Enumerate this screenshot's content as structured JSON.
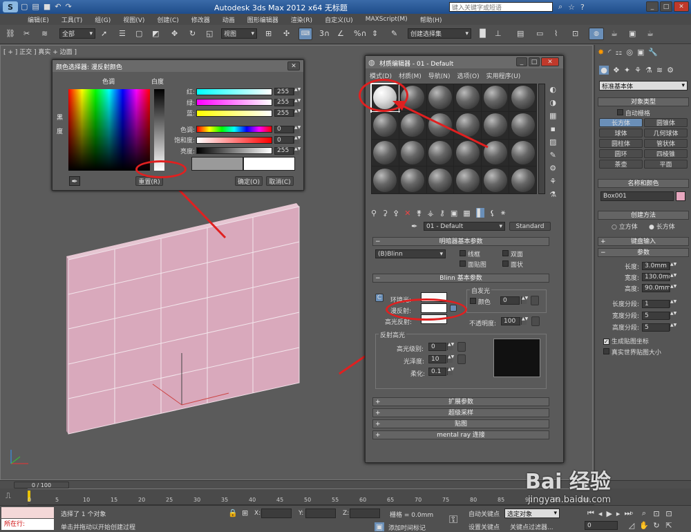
{
  "titlebar": {
    "title": "Autodesk 3ds Max  2012 x64      无标题",
    "search_placeholder": "键入关键字或短语"
  },
  "menu": [
    "编辑(E)",
    "工具(T)",
    "组(G)",
    "视图(V)",
    "创建(C)",
    "修改器",
    "动画",
    "图形编辑器",
    "渲染(R)",
    "自定义(U)",
    "MAXScript(M)",
    "帮助(H)"
  ],
  "toolbar": {
    "filter": "全部",
    "view": "视图",
    "selset": "创建选择集",
    "spinner_label": "3"
  },
  "viewport_label": "[ + ] 正交 ] 真实 + 边面 ]",
  "color_picker": {
    "title": "颜色选择器: 漫反射颜色",
    "hue_label": "色调",
    "white_label": "白度",
    "black_label": "黑",
    "deg_label": "度",
    "rows": [
      {
        "label": "红:",
        "value": "255",
        "grad": "linear-gradient(90deg,#0ff,#fff)"
      },
      {
        "label": "绿:",
        "value": "255",
        "grad": "linear-gradient(90deg,#f0f,#fff)"
      },
      {
        "label": "蓝:",
        "value": "255",
        "grad": "linear-gradient(90deg,#ff0,#fff)"
      },
      {
        "label": "色调:",
        "value": "0",
        "grad": "linear-gradient(90deg,#f00,#ff0,#0f0,#0ff,#00f,#f0f,#f00)"
      },
      {
        "label": "饱和度:",
        "value": "0",
        "grad": "linear-gradient(90deg,#fff,#f00)"
      },
      {
        "label": "亮度:",
        "value": "255",
        "grad": "linear-gradient(90deg,#000,#fff)"
      }
    ],
    "reset": "重置(R)",
    "ok": "确定(O)",
    "cancel": "取消(C)"
  },
  "mat_editor": {
    "title": "材质编辑器 - 01 - Default",
    "menu": [
      "模式(D)",
      "材质(M)",
      "导航(N)",
      "选项(O)",
      "实用程序(U)"
    ],
    "material_name": "01 - Default",
    "material_type": "Standard",
    "shader_rollout": "明暗器基本参数",
    "shader": "(B)Blinn",
    "wire": "线框",
    "two_sided": "双面",
    "face_map": "面贴图",
    "faceted": "面状",
    "blinn_rollout": "Blinn 基本参数",
    "self_illum": "自发光",
    "color_label": "颜色",
    "self_val": "0",
    "ambient": "环境光:",
    "diffuse": "漫反射:",
    "specular": "高光反射:",
    "opacity_label": "不透明度:",
    "opacity": "100",
    "highlight_group": "反射高光",
    "spec_level_label": "高光级别:",
    "spec_level": "0",
    "gloss_label": "光泽度:",
    "gloss": "10",
    "soften_label": "柔化:",
    "soften": "0.1",
    "rollouts": [
      "扩展参数",
      "超级采样",
      "贴图",
      "mental ray 连接"
    ]
  },
  "command_panel": {
    "category": "标准基本体",
    "object_type": "对象类型",
    "autogrid": "自动栅格",
    "objects": [
      "长方体",
      "圆锥体",
      "球体",
      "几何球体",
      "圆柱体",
      "管状体",
      "圆环",
      "四棱锥",
      "茶壶",
      "平面"
    ],
    "name_color": "名称和颜色",
    "object_name": "Box001",
    "obj_color": "#e8a8c0",
    "creation_method": "创建方法",
    "cube": "立方体",
    "box": "长方体",
    "keyboard": "键盘输入",
    "params": "参数",
    "params_rows": [
      {
        "label": "长度:",
        "value": "3.0mm"
      },
      {
        "label": "宽度:",
        "value": "130.0mm"
      },
      {
        "label": "高度:",
        "value": "90.0mm"
      },
      {
        "label": "长度分段:",
        "value": "1"
      },
      {
        "label": "宽度分段:",
        "value": "5"
      },
      {
        "label": "高度分段:",
        "value": "5"
      }
    ],
    "gen_uv": "生成贴图坐标",
    "real_world": "真实世界贴图大小"
  },
  "timeline": {
    "frame": "0 / 100",
    "ticks": [
      "0",
      "5",
      "10",
      "15",
      "20",
      "25",
      "30",
      "35",
      "40",
      "45",
      "50",
      "55",
      "60",
      "65",
      "70",
      "75",
      "80",
      "85",
      "90",
      "95",
      "100"
    ]
  },
  "status": {
    "location": "所在行:",
    "selected": "选择了 1 个对象",
    "hint": "单击并拖动以开始创建过程",
    "x": "X:",
    "y": "Y:",
    "z": "Z:",
    "grid": "栅格 = 0.0mm",
    "add_tag": "添加时间标记",
    "auto_key": "自动关键点",
    "set_key": "设置关键点",
    "sel_obj": "选定对象",
    "key_filter": "关键点过滤器...",
    "frame_val": "0"
  },
  "watermark": {
    "brand": "Bai  经验",
    "url": "jingyan.baidu.com"
  }
}
